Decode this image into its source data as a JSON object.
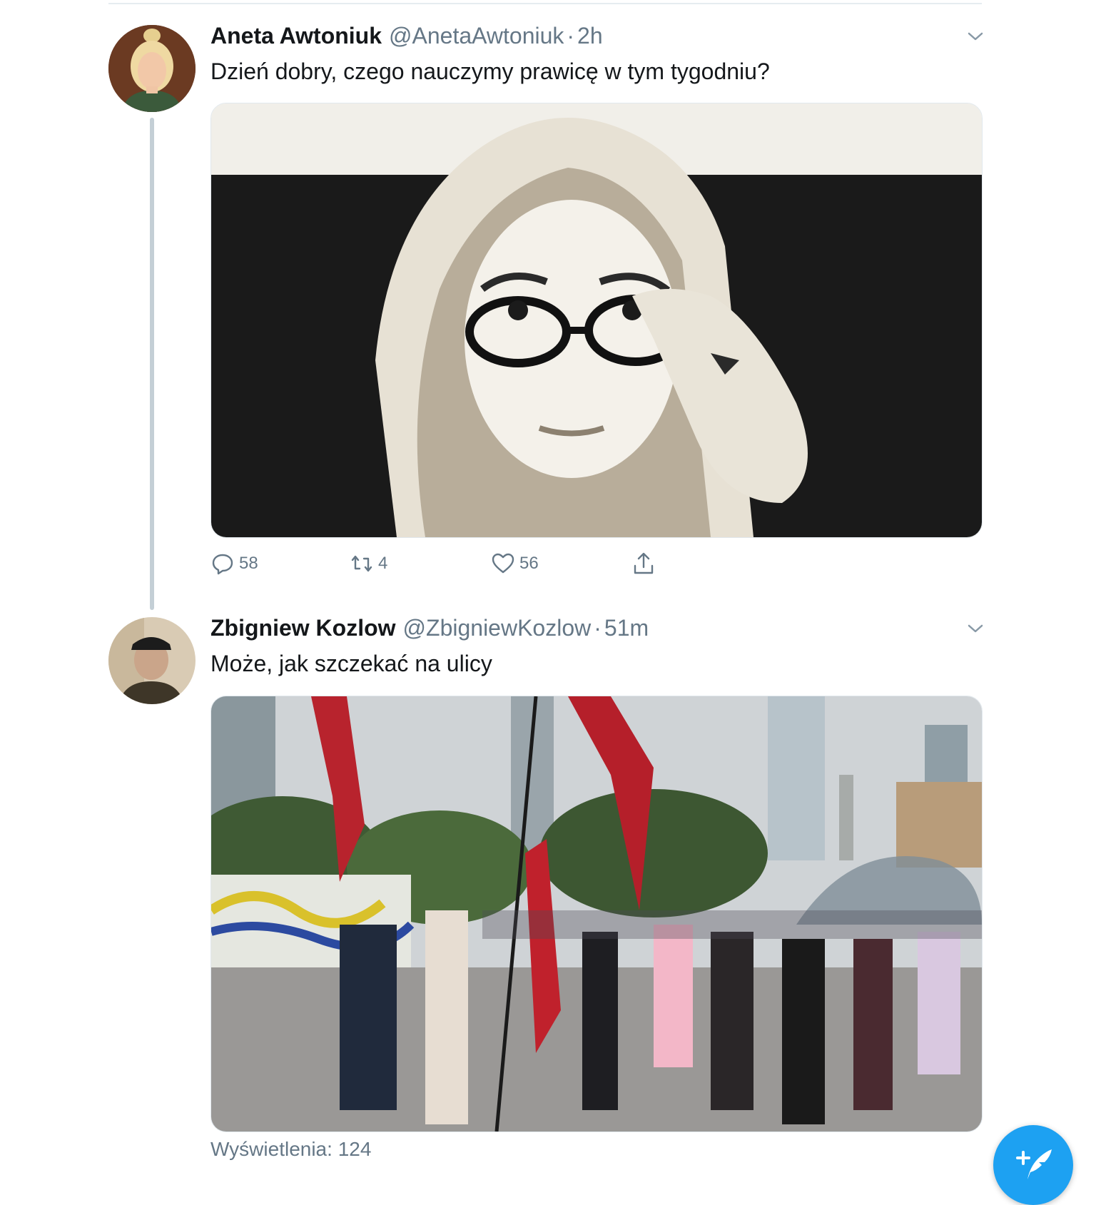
{
  "tweets": [
    {
      "name": "Aneta Awtoniuk",
      "handle": "@AnetaAwtoniuk",
      "separator": "·",
      "time": "2h",
      "text": "Dzień dobry, czego nauczymy prawicę w tym tygodniu?",
      "actions": {
        "replies": "58",
        "retweets": "4",
        "likes": "56"
      }
    },
    {
      "name": "Zbigniew Kozlow",
      "handle": "@ZbigniewKozlow",
      "separator": "·",
      "time": "51m",
      "text": "Może, jak szczekać na ulicy",
      "views": "Wyświetlenia: 124"
    }
  ],
  "colors": {
    "accent": "#1da1f2",
    "secondary_text": "#657786",
    "thread_line": "#c4cfd6"
  },
  "icons": [
    "chevron-down-icon",
    "reply-icon",
    "retweet-icon",
    "like-icon",
    "share-icon",
    "compose-tweet-icon"
  ]
}
